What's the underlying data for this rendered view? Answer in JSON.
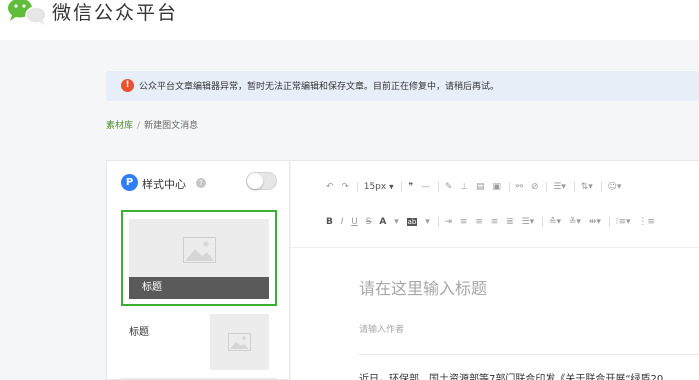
{
  "header": {
    "brand": "微信公众平台"
  },
  "alert": {
    "message": "公众平台文章编辑器异常，暂时无法正常编辑和保存文章。目前正在修复中，请稍后再试。"
  },
  "breadcrumb": {
    "parent": "素材库",
    "separator": "/",
    "current": "新建图文消息"
  },
  "style_center": {
    "badge": "P",
    "label": "样式中心",
    "help": "?",
    "enabled": false
  },
  "articles": [
    {
      "title": "标题",
      "selected": true
    },
    {
      "title": "标题",
      "selected": false
    }
  ],
  "toolbar": {
    "row1": {
      "font_size": "15px"
    },
    "row2": {
      "bold": "B",
      "italic": "I",
      "underline": "U",
      "strike": "S",
      "font_color": "A"
    }
  },
  "editor": {
    "title_placeholder": "请在这里输入标题",
    "author_placeholder": "请输入作者",
    "body_text": "近日，环保部、国土资源部等7部门联合印发《关于联合开展“绿盾20"
  },
  "colors": {
    "accent_green": "#3cb034",
    "link_green": "#4a8f2a",
    "alert_bg": "#e8eef8",
    "alert_icon": "#e8522e",
    "style_badge": "#2f7ef7"
  }
}
